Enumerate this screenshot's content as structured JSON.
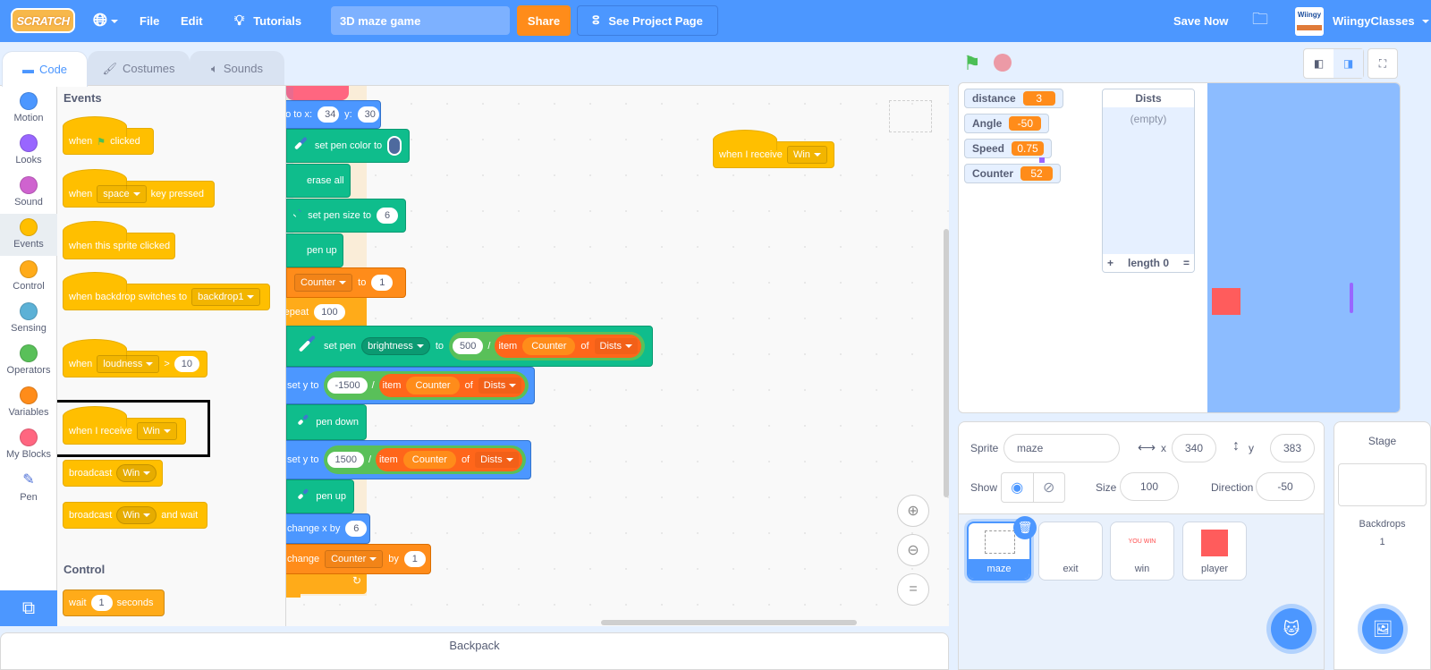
{
  "menubar": {
    "logo": "SCRATCH",
    "language_icon": "globe-icon",
    "file": "File",
    "edit": "Edit",
    "tutorials": "Tutorials",
    "project_title": "3D maze game",
    "share": "Share",
    "see_project_page": "See Project Page",
    "save_now": "Save Now",
    "username": "WiingyClasses",
    "avatar_text": "Wiingy"
  },
  "tabs": [
    {
      "label": "Code",
      "icon": "code-icon",
      "active": true
    },
    {
      "label": "Costumes",
      "icon": "brush-icon",
      "active": false
    },
    {
      "label": "Sounds",
      "icon": "speaker-icon",
      "active": false
    }
  ],
  "categories": [
    {
      "label": "Motion",
      "color": "#4c97ff"
    },
    {
      "label": "Looks",
      "color": "#9966ff"
    },
    {
      "label": "Sound",
      "color": "#cf63cf"
    },
    {
      "label": "Events",
      "color": "#ffbf00",
      "selected": true
    },
    {
      "label": "Control",
      "color": "#ffab19"
    },
    {
      "label": "Sensing",
      "color": "#5cb1d6"
    },
    {
      "label": "Operators",
      "color": "#59c059"
    },
    {
      "label": "Variables",
      "color": "#ff8c1a"
    },
    {
      "label": "My Blocks",
      "color": "#ff6680"
    },
    {
      "label": "Pen",
      "color": "pen-icon"
    }
  ],
  "palette": {
    "events_header": "Events",
    "control_header": "Control",
    "when_flag": {
      "pre": "when",
      "post": "clicked"
    },
    "when_key": {
      "pre": "when",
      "key": "space",
      "post": "key pressed"
    },
    "when_sprite_clicked": "when this sprite clicked",
    "when_backdrop": {
      "pre": "when backdrop switches to",
      "value": "backdrop1"
    },
    "when_loudness": {
      "pre": "when",
      "value": "loudness",
      "op": ">",
      "num": "10"
    },
    "when_receive": {
      "pre": "when I receive",
      "value": "Win"
    },
    "broadcast": {
      "pre": "broadcast",
      "value": "Win"
    },
    "broadcast_wait": {
      "pre": "broadcast",
      "value": "Win",
      "post": "and wait"
    },
    "wait": {
      "pre": "wait",
      "num": "1",
      "post": "seconds"
    }
  },
  "script": {
    "goto": {
      "label": "go to x:",
      "x": "34",
      "ylabel": "y:",
      "y": "30"
    },
    "set_pen_color": "set pen color to",
    "erase_all": "erase all",
    "set_pen_size": {
      "label": "set pen size to",
      "value": "6"
    },
    "pen_up_1": "pen up",
    "set_var": {
      "var": "Counter",
      "to": "to",
      "value": "1"
    },
    "repeat": {
      "label": "repeat",
      "value": "100"
    },
    "set_pen_param": {
      "label": "set pen",
      "param": "brightness",
      "to": "to",
      "num": "500",
      "div": "/",
      "item": "item",
      "idx": "Counter",
      "of": "of",
      "list": "Dists"
    },
    "set_y_1": {
      "label": "set y to",
      "num": "-1500",
      "div": "/",
      "item": "item",
      "idx": "Counter",
      "of": "of",
      "list": "Dists"
    },
    "pen_down": "pen down",
    "set_y_2": {
      "label": "set y to",
      "num": "1500",
      "div": "/",
      "item": "item",
      "idx": "Counter",
      "of": "of",
      "list": "Dists"
    },
    "pen_up_2": "pen up",
    "change_x": {
      "label": "change x by",
      "value": "6"
    },
    "change_var": {
      "label": "change",
      "var": "Counter",
      "by": "by",
      "value": "1"
    },
    "floating_receive": {
      "label": "when I receive",
      "value": "Win"
    }
  },
  "backpack": "Backpack",
  "monitors": [
    {
      "name": "distance",
      "value": "3"
    },
    {
      "name": "Angle",
      "value": "-50"
    },
    {
      "name": "Speed",
      "value": "0.75"
    },
    {
      "name": "Counter",
      "value": "52"
    }
  ],
  "list_monitor": {
    "name": "Dists",
    "empty": "(empty)",
    "add": "+",
    "length": "length 0",
    "resize": "="
  },
  "sprite_info": {
    "sprite_label": "Sprite",
    "sprite_name": "maze",
    "x_label": "x",
    "x": "340",
    "y_label": "y",
    "y": "383",
    "show_label": "Show",
    "size_label": "Size",
    "size": "100",
    "direction_label": "Direction",
    "direction": "-50"
  },
  "sprites": [
    {
      "name": "maze",
      "selected": true
    },
    {
      "name": "exit"
    },
    {
      "name": "win",
      "thumb_text": "YOU WIN"
    },
    {
      "name": "player"
    }
  ],
  "stage_pane": {
    "title": "Stage",
    "backdrops_label": "Backdrops",
    "backdrops_count": "1"
  }
}
